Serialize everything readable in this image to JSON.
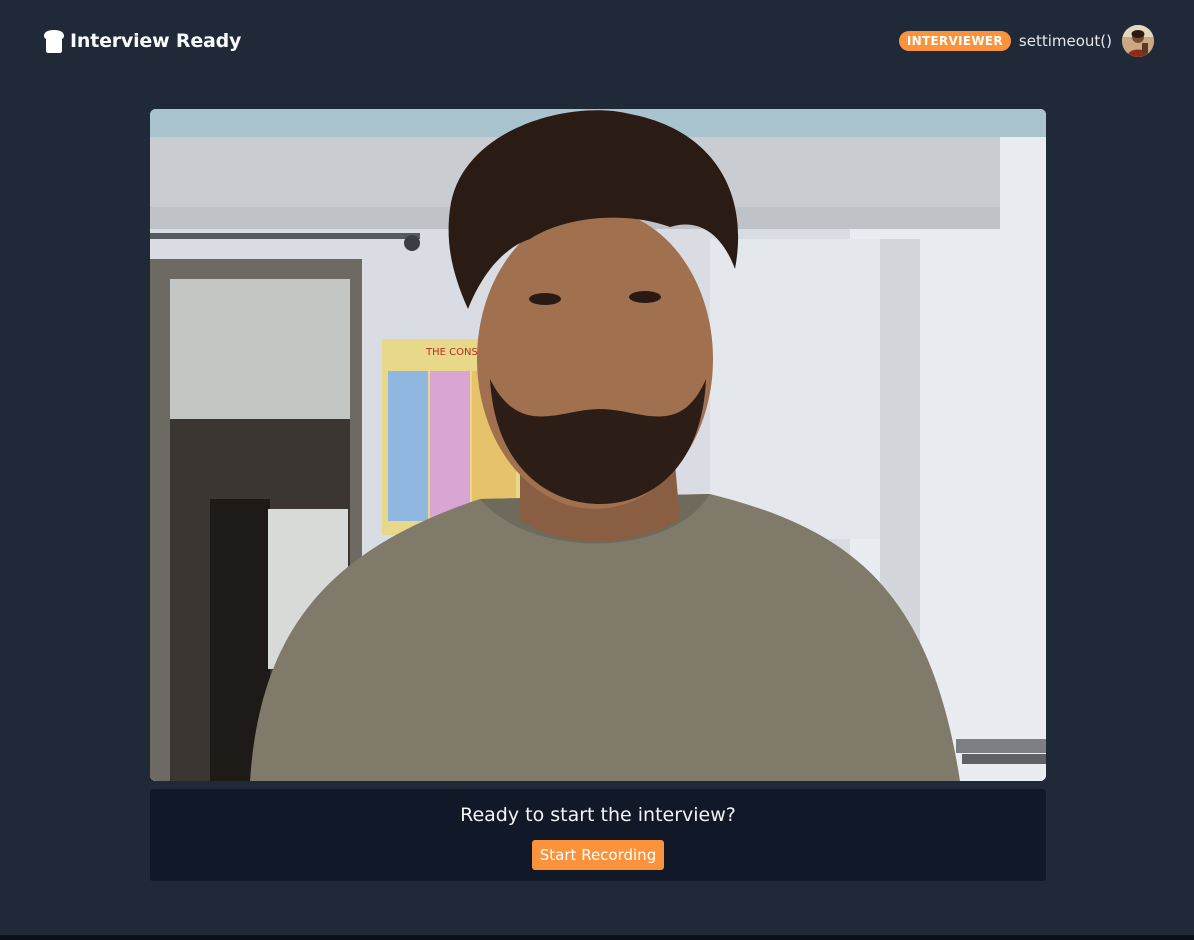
{
  "header": {
    "brand": {
      "title": "Interview Ready",
      "icon": "bread-slice-icon"
    },
    "user": {
      "role": "INTERVIEWER",
      "name": "settimeout()",
      "avatar": "user-avatar"
    }
  },
  "camera": {
    "icon": "webcam-preview"
  },
  "prompt": {
    "text": "Ready to start the interview?",
    "button_label": "Start Recording"
  },
  "colors": {
    "background": "#1f2937",
    "panel": "#111827",
    "accent": "#fb923c"
  }
}
